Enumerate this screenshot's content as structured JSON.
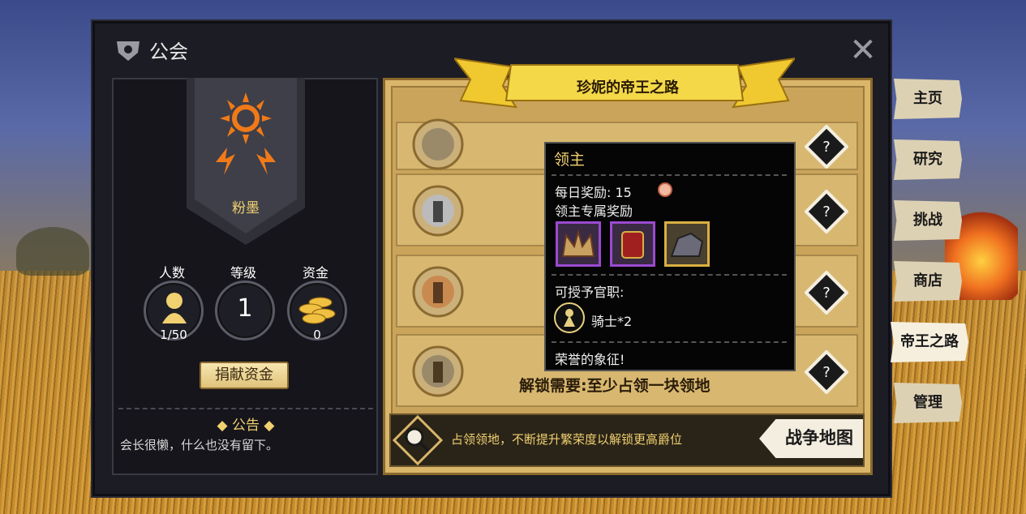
{
  "window": {
    "title": "公会"
  },
  "guild": {
    "name": "粉墨",
    "stats": [
      {
        "label": "人数",
        "value": "1/50",
        "icon": "member-icon"
      },
      {
        "label": "等级",
        "value": "1",
        "icon": "level-icon"
      },
      {
        "label": "资金",
        "value": "0",
        "icon": "gold-coins-icon"
      }
    ],
    "donate_label": "捐献资金",
    "notice_title": "◆ 公告 ◆",
    "notice_text": "会长很懒，什么也没有留下。"
  },
  "road": {
    "ribbon_title": "珍妮的帝王之路",
    "unlock_text": "解锁需要:至少占领一块领地",
    "tip_text": "占领领地，不断提升繁荣度以解锁更高爵位",
    "war_map_label": "战争地图"
  },
  "tooltip": {
    "title": "领主",
    "daily_reward": "每日奖励: 15",
    "exclusive_reward": "领主专属奖励",
    "grant_label": "可授予官职:",
    "grant_value": "骑士*2",
    "honor_text": "荣誉的象征!"
  },
  "side_tabs": [
    {
      "label": "主页",
      "active": false
    },
    {
      "label": "研究",
      "active": false
    },
    {
      "label": "挑战",
      "active": false
    },
    {
      "label": "商店",
      "active": false
    },
    {
      "label": "帝王之路",
      "active": true
    },
    {
      "label": "管理",
      "active": false
    }
  ],
  "colors": {
    "gold_text": "#f0d070",
    "panel_tan": "#d9b66a",
    "dark_bg": "#15151b"
  }
}
